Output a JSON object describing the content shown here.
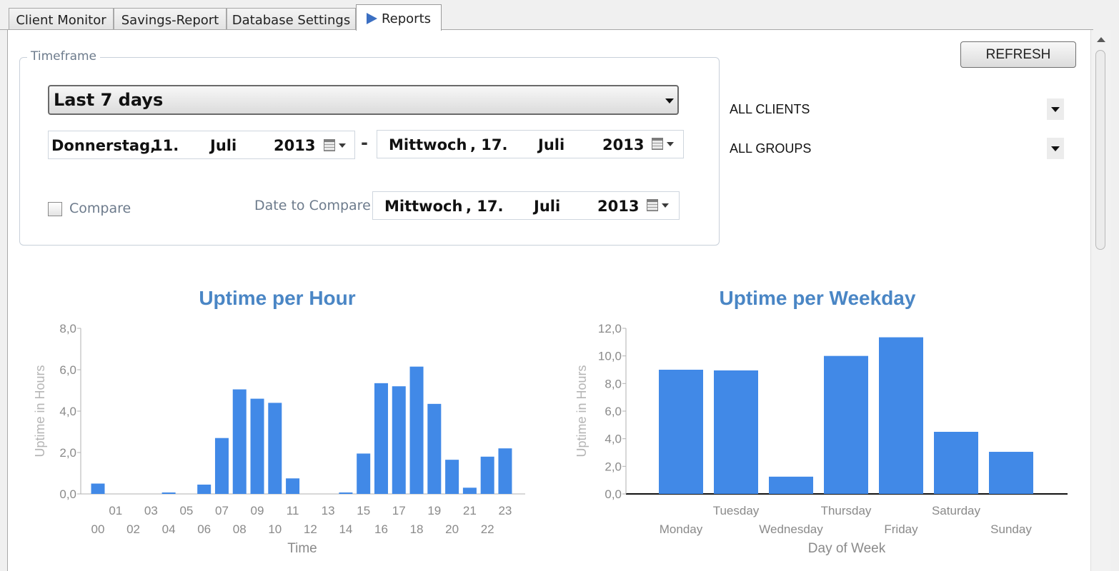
{
  "tabs": [
    {
      "label": "Client Monitor",
      "active": false
    },
    {
      "label": "Savings-Report",
      "active": false
    },
    {
      "label": "Database Settings",
      "active": false
    },
    {
      "label": "Reports",
      "active": true
    }
  ],
  "timeframe": {
    "legend": "Timeframe",
    "period": "Last 7 days",
    "from_date": {
      "weekday": "Donnerstag,",
      "day": "11.",
      "month": "Juli",
      "year": "2013"
    },
    "separator": "-",
    "to_date": {
      "weekday": "Mittwoch",
      "day": ", 17.",
      "month": "Juli",
      "year": "2013"
    },
    "compare_label": "Compare",
    "compare_checked": false,
    "date_to_compare_label": "Date to Compare:",
    "compare_date": {
      "weekday": "Mittwoch",
      "day": ", 17.",
      "month": "Juli",
      "year": "2013"
    }
  },
  "actions": {
    "refresh_label": "REFRESH"
  },
  "filters": {
    "clients": "ALL CLIENTS",
    "groups": "ALL GROUPS"
  },
  "colors": {
    "bar": "#4189e7",
    "title": "#4a86c5",
    "axis_text": "#8a8a8a"
  },
  "chart_data": [
    {
      "type": "bar",
      "title": "Uptime per Hour",
      "xlabel": "Time",
      "ylabel": "Uptime in Hours",
      "ylim": [
        0,
        8
      ],
      "yticks": [
        "0,0",
        "2,0",
        "4,0",
        "6,0",
        "8,0"
      ],
      "categories": [
        "00",
        "01",
        "02",
        "03",
        "04",
        "05",
        "06",
        "07",
        "08",
        "09",
        "10",
        "11",
        "12",
        "13",
        "14",
        "15",
        "16",
        "17",
        "18",
        "19",
        "20",
        "21",
        "22",
        "23"
      ],
      "values": [
        0.5,
        0,
        0,
        0,
        0.07,
        0,
        0.45,
        2.7,
        5.05,
        4.6,
        4.4,
        0.75,
        0,
        0,
        0.07,
        1.95,
        5.35,
        5.2,
        6.15,
        4.35,
        1.65,
        0.3,
        1.8,
        2.2
      ]
    },
    {
      "type": "bar",
      "title": "Uptime per Weekday",
      "xlabel": "Day of Week",
      "ylabel": "Uptime in Hours",
      "ylim": [
        0,
        12
      ],
      "yticks": [
        "0,0",
        "2,0",
        "4,0",
        "6,0",
        "8,0",
        "10,0",
        "12,0"
      ],
      "categories": [
        "Monday",
        "Tuesday",
        "Wednesday",
        "Thursday",
        "Friday",
        "Saturday",
        "Sunday"
      ],
      "values": [
        9.0,
        8.95,
        1.25,
        10.0,
        11.35,
        4.5,
        3.05
      ]
    }
  ]
}
